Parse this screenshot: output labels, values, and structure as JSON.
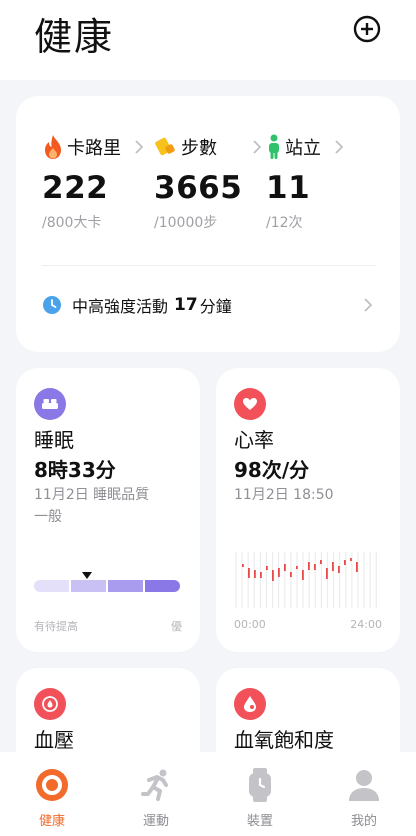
{
  "header": {
    "title": "健康"
  },
  "summary": {
    "metrics": [
      {
        "label": "卡路里",
        "value": "222",
        "goal": "/800大卡",
        "icon": "flame-icon"
      },
      {
        "label": "步數",
        "value": "3665",
        "goal": "/10000步",
        "icon": "shoe-icon"
      },
      {
        "label": "站立",
        "value": "11",
        "goal": "/12次",
        "icon": "standing-person-icon"
      }
    ],
    "intensity": {
      "text": "中高強度活動",
      "value": "17",
      "unit": "分鐘"
    }
  },
  "sleep": {
    "title": "睡眠",
    "value": "8時33分",
    "sub_line1": "11月2日 睡眠品質",
    "sub_line2": "一般",
    "bar_low_label": "有待提高",
    "bar_high_label": "優",
    "quality_segments": [
      "#e4e0fa",
      "#c9c0f4",
      "#a99cee",
      "#8a78e6"
    ]
  },
  "heart": {
    "title": "心率",
    "value": "98次/分",
    "sub": "11月2日 18:50",
    "time_start": "00:00",
    "time_end": "24:00"
  },
  "blood_pressure": {
    "title": "血壓"
  },
  "spo2": {
    "title": "血氧飽和度"
  },
  "tabs": [
    {
      "label": "健康",
      "active": true,
      "icon": "health-ring-icon"
    },
    {
      "label": "運動",
      "active": false,
      "icon": "running-icon"
    },
    {
      "label": "裝置",
      "active": false,
      "icon": "watch-icon"
    },
    {
      "label": "我的",
      "active": false,
      "icon": "profile-icon"
    }
  ],
  "colors": {
    "accent": "#f26b2a",
    "flame": "#f25a22",
    "steps": "#f7c21c",
    "stand": "#2fc26b",
    "clock": "#4aa3ea",
    "sleep": "#8a78e6",
    "heart": "#f2515a",
    "chart_bar": "#e84a4a"
  }
}
